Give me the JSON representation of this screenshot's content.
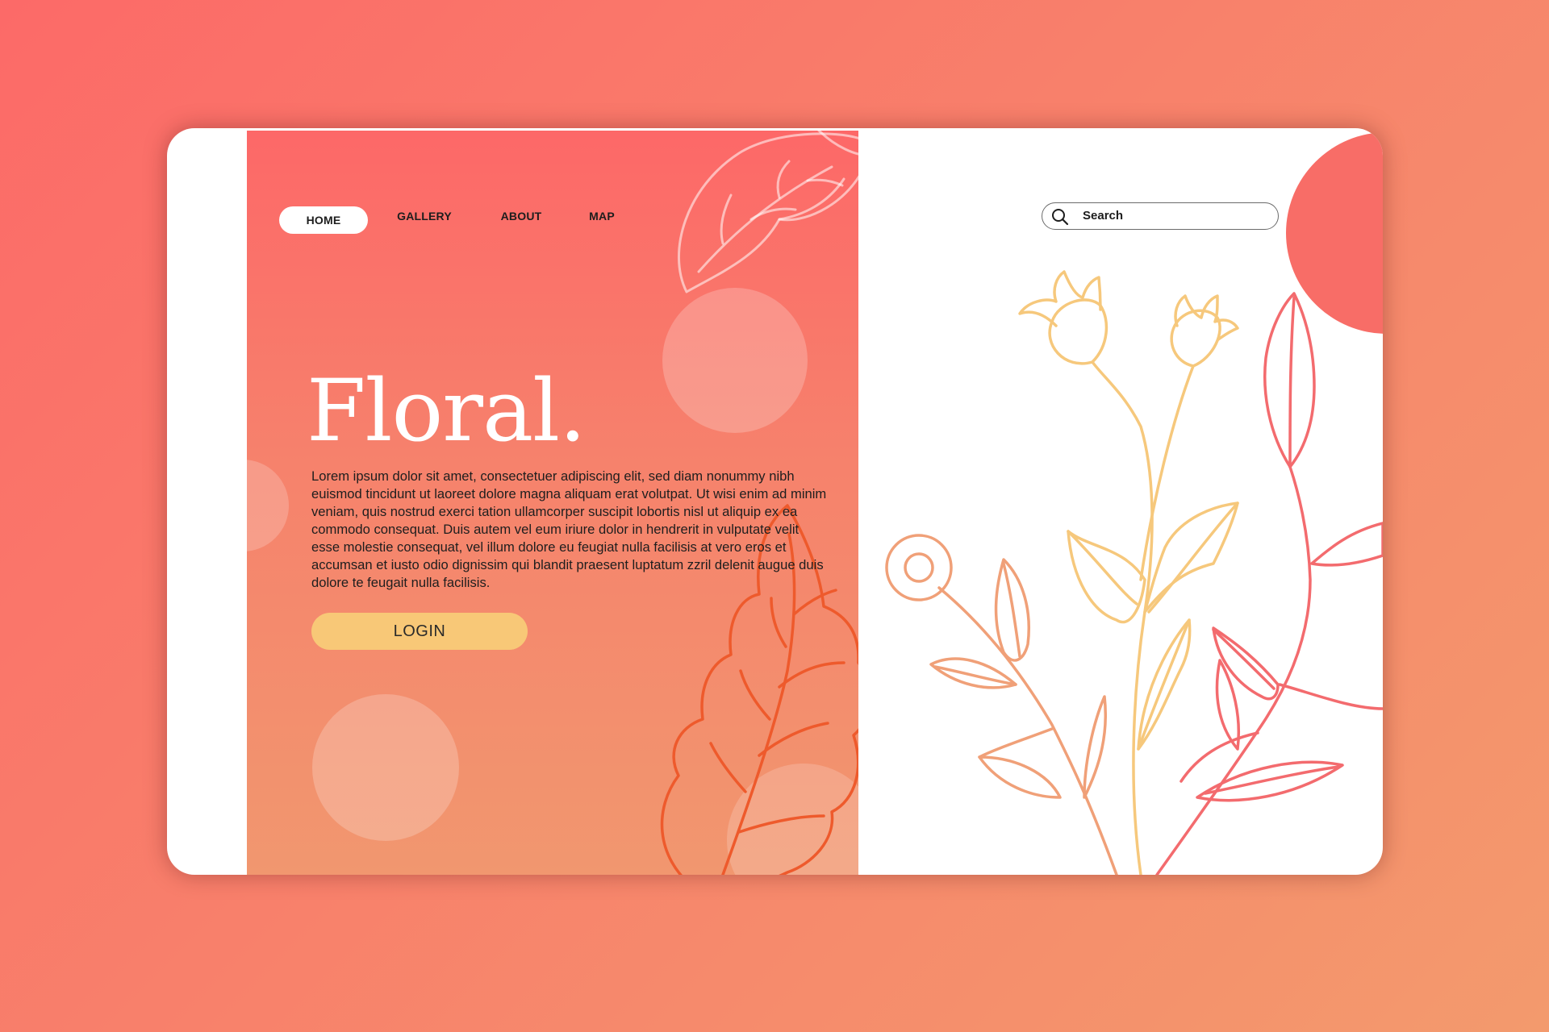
{
  "colors": {
    "background_start": "#fc6a68",
    "background_end": "#f39a6d",
    "hero_top": "#fd6868",
    "hero_bottom": "#f1976f",
    "button": "#f8c877",
    "flower_yellow": "#f6c87c",
    "flower_peach": "#f0a078",
    "flower_pink": "#f36b6e",
    "leaf_orange": "#ee5a2c"
  },
  "nav": {
    "items": [
      {
        "label": "HOME",
        "active": true
      },
      {
        "label": "GALLERY",
        "active": false
      },
      {
        "label": "ABOUT",
        "active": false
      },
      {
        "label": "MAP",
        "active": false
      }
    ]
  },
  "hero": {
    "title": "Floral.",
    "body": "Lorem ipsum dolor sit amet, consectetuer adipiscing elit, sed diam nonummy nibh euismod tincidunt ut laoreet dolore magna aliquam erat volutpat. Ut wisi enim ad minim veniam, quis nostrud exerci tation ullamcorper suscipit lobortis nisl ut aliquip ex ea commodo consequat. Duis autem vel eum iriure dolor in hendrerit in vulputate velit esse molestie consequat, vel illum dolore eu feugiat nulla facilisis at vero eros et accumsan et iusto odio dignissim qui blandit praesent luptatum zzril delenit augue duis dolore te feugait nulla facilisis.",
    "login_label": "LOGIN"
  },
  "search": {
    "placeholder": "Search",
    "icon": "search-icon"
  },
  "decorations": {
    "icons": [
      "leaf-outline-icon",
      "leaf-orange-icon",
      "flower-illustration"
    ]
  }
}
